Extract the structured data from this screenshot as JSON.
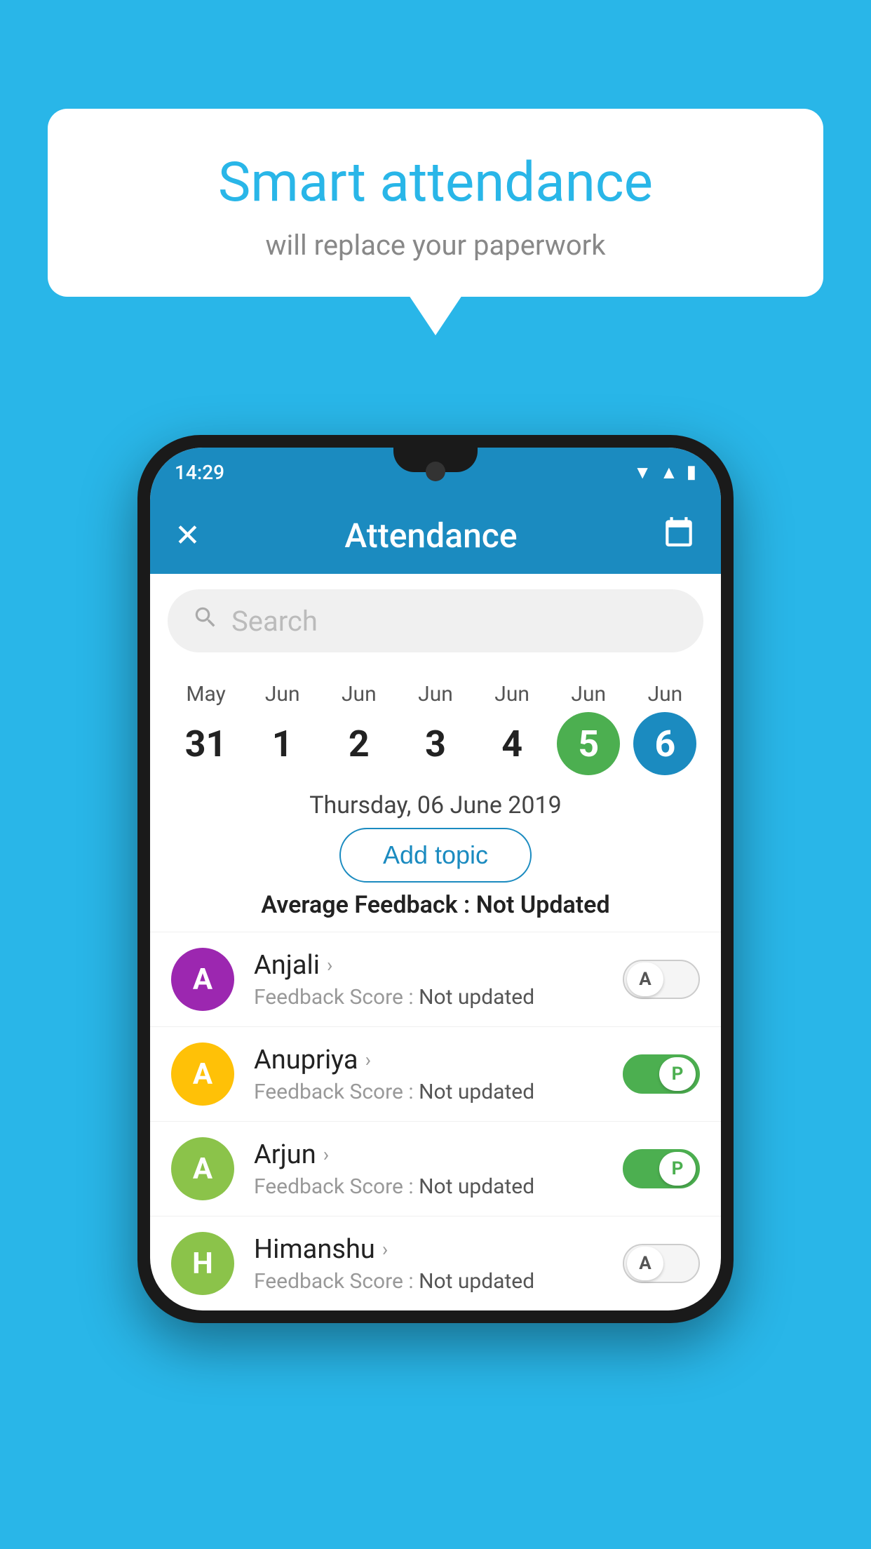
{
  "background_color": "#29B6E8",
  "bubble": {
    "title": "Smart attendance",
    "subtitle": "will replace your paperwork"
  },
  "status_bar": {
    "time": "14:29"
  },
  "app_bar": {
    "title": "Attendance",
    "close_label": "✕",
    "calendar_label": "📅"
  },
  "search": {
    "placeholder": "Search"
  },
  "calendar": {
    "days": [
      {
        "month": "May",
        "date": "31",
        "style": "normal"
      },
      {
        "month": "Jun",
        "date": "1",
        "style": "normal"
      },
      {
        "month": "Jun",
        "date": "2",
        "style": "normal"
      },
      {
        "month": "Jun",
        "date": "3",
        "style": "normal"
      },
      {
        "month": "Jun",
        "date": "4",
        "style": "normal"
      },
      {
        "month": "Jun",
        "date": "5",
        "style": "today"
      },
      {
        "month": "Jun",
        "date": "6",
        "style": "selected"
      }
    ],
    "selected_date_text": "Thursday, 06 June 2019"
  },
  "add_topic_label": "Add topic",
  "average_feedback": {
    "label": "Average Feedback : ",
    "value": "Not Updated"
  },
  "students": [
    {
      "name": "Anjali",
      "avatar_color": "#9C27B0",
      "avatar_letter": "A",
      "score_label": "Feedback Score : ",
      "score_value": "Not updated",
      "toggle_state": "off",
      "toggle_label": "A"
    },
    {
      "name": "Anupriya",
      "avatar_color": "#FFC107",
      "avatar_letter": "A",
      "score_label": "Feedback Score : ",
      "score_value": "Not updated",
      "toggle_state": "on",
      "toggle_label": "P"
    },
    {
      "name": "Arjun",
      "avatar_color": "#8BC34A",
      "avatar_letter": "A",
      "score_label": "Feedback Score : ",
      "score_value": "Not updated",
      "toggle_state": "on",
      "toggle_label": "P"
    },
    {
      "name": "Himanshu",
      "avatar_color": "#8BC34A",
      "avatar_letter": "H",
      "score_label": "Feedback Score : ",
      "score_value": "Not updated",
      "toggle_state": "off",
      "toggle_label": "A"
    }
  ]
}
